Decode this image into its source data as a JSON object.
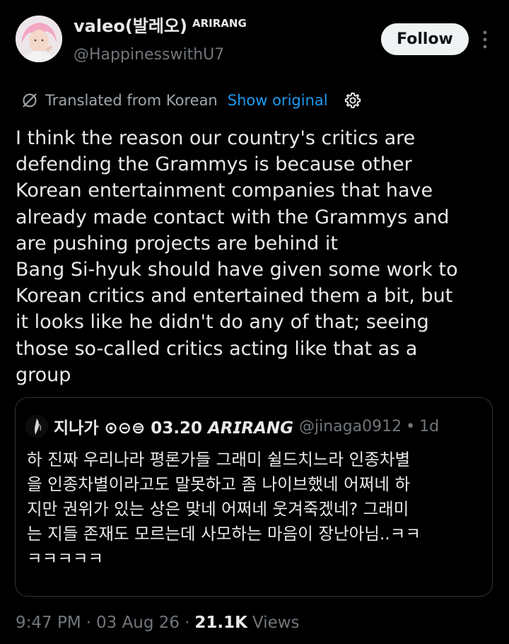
{
  "author": {
    "display_name": "valeo(발레오)",
    "name_suffix": "ARIRANG",
    "handle": "@HappinesswithU7",
    "avatar_icon": "profile-avatar"
  },
  "actions": {
    "follow_label": "Follow",
    "more_icon": "more-vertical-icon"
  },
  "translation": {
    "label": "Translated from Korean",
    "show_original": "Show original",
    "translate_icon": "translate-off-icon",
    "settings_icon": "gear-icon"
  },
  "tweet": {
    "lines": [
      "I think the reason our country's critics are",
      "defending the Grammys is because other",
      "Korean entertainment companies that have",
      "already made contact with the Grammys and",
      "are pushing projects are behind it",
      "Bang Si-hyuk should have given some work to",
      "Korean critics and entertained them a bit, but",
      "it looks like he didn't do any of that; seeing",
      "those so-called critics acting like that as a",
      "group"
    ]
  },
  "quote": {
    "name": "지나가 ⊙⊝⊜ 03.20 𝘼𝙍𝙄𝙍𝘼𝙉𝙂",
    "handle": "@jinaga0912",
    "dot": "•",
    "time": "1d",
    "lines": [
      "하 진짜 우리나라 평론가들 그래미 쉴드치느라 인종차별",
      "을 인종차별이라고도 말못하고 좀 나이브했네 어쩌네 하",
      "지만 권위가 있는 상은 맞네 어쩌네 웃겨죽겠네? 그래미",
      "는 지들 존재도 모르는데 사모하는 마음이 장난아님..ㅋㅋ",
      "ㅋㅋㅋㅋㅋ"
    ]
  },
  "meta": {
    "time": "9:47 PM",
    "sep1": "·",
    "date": "03 Aug 26",
    "sep2": "·",
    "views_count": "21.1K",
    "views_label": "Views"
  },
  "colors": {
    "background": "#000000",
    "text": "#e7e9ea",
    "secondary": "#71767b",
    "link": "#1d9bf0",
    "border": "#2f3336"
  }
}
